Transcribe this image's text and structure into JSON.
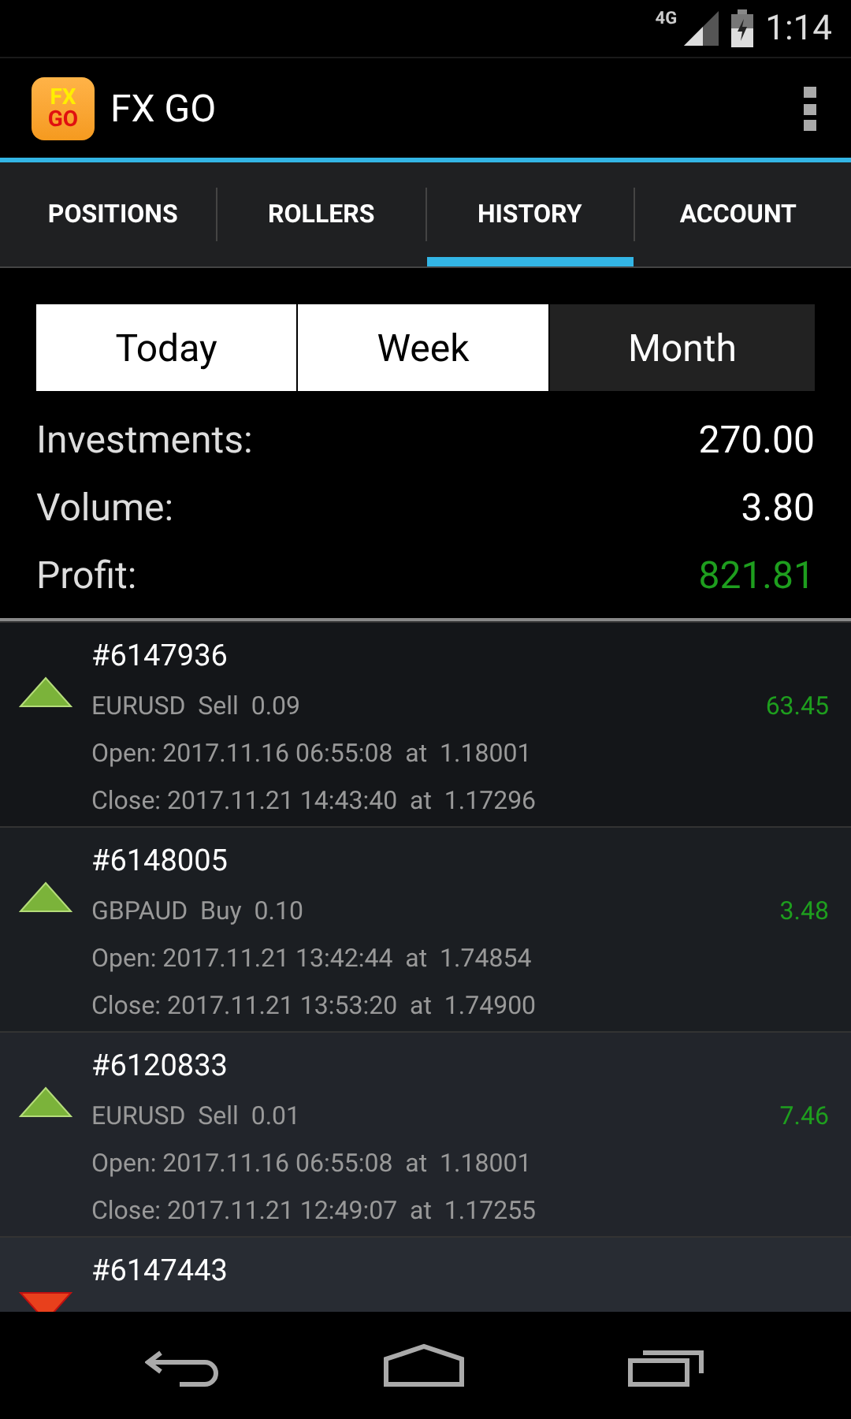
{
  "status_bar": {
    "network": "4G",
    "time": "1:14"
  },
  "app_bar": {
    "logo_top": "FX",
    "logo_bottom": "GO",
    "title": "FX GO"
  },
  "tabs": [
    {
      "label": "POSITIONS",
      "selected": false
    },
    {
      "label": "ROLLERS",
      "selected": false
    },
    {
      "label": "HISTORY",
      "selected": true
    },
    {
      "label": "ACCOUNT",
      "selected": false
    }
  ],
  "periods": [
    {
      "label": "Today",
      "selected": false
    },
    {
      "label": "Week",
      "selected": false
    },
    {
      "label": "Month",
      "selected": true
    }
  ],
  "summary": [
    {
      "label": "Investments:",
      "value": "270.00",
      "kind": "plain"
    },
    {
      "label": "Volume:",
      "value": "3.80",
      "kind": "plain"
    },
    {
      "label": "Profit:",
      "value": "821.81",
      "kind": "profit"
    }
  ],
  "trades": [
    {
      "kind": "up",
      "ticket": "#6147936",
      "details": "EURUSD  Sell  0.09",
      "profit": "63.45",
      "open": "Open: 2017.11.16 06:55:08  at  1.18001",
      "close": "Close: 2017.11.21 14:43:40  at  1.17296"
    },
    {
      "kind": "up",
      "ticket": "#6148005",
      "details": "GBPAUD  Buy  0.10",
      "profit": "3.48",
      "open": "Open: 2017.11.21 13:42:44  at  1.74854",
      "close": "Close: 2017.11.21 13:53:20  at  1.74900"
    },
    {
      "kind": "up",
      "ticket": "#6120833",
      "details": "EURUSD  Sell  0.01",
      "profit": "7.46",
      "open": "Open: 2017.11.16 06:55:08  at  1.18001",
      "close": "Close: 2017.11.21 12:49:07  at  1.17255"
    },
    {
      "kind": "down",
      "ticket": "#6147443"
    }
  ]
}
